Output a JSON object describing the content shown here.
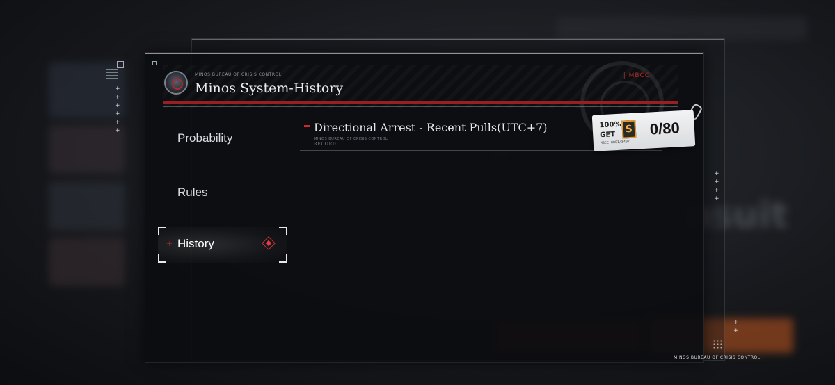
{
  "background": {
    "blurred_word": "nsuit"
  },
  "panel": {
    "bureau_label": "MINOS BUREAU OF CRISIS CONTROL",
    "title": "Minos System-History",
    "tag": "| MBCC"
  },
  "nav": {
    "items": [
      {
        "label": "Probability"
      },
      {
        "label": "Rules"
      },
      {
        "label": "History"
      }
    ]
  },
  "content": {
    "title": "Directional Arrest - Recent Pulls(UTC+7)",
    "sub_bureau": "MINOS BUREAU OF CRISIS CONTROL",
    "sub_record": "RECORD"
  },
  "counter": {
    "line1": "100%",
    "line2": "GET",
    "grade": "S",
    "code": "MBCC 0001/3407",
    "count": "0/80"
  },
  "footer": {
    "text": "MINOS BUREAU OF CRISIS CONTROL"
  },
  "colors": {
    "accent_red": "#d1272e",
    "grade_orange": "#e39b2b"
  }
}
